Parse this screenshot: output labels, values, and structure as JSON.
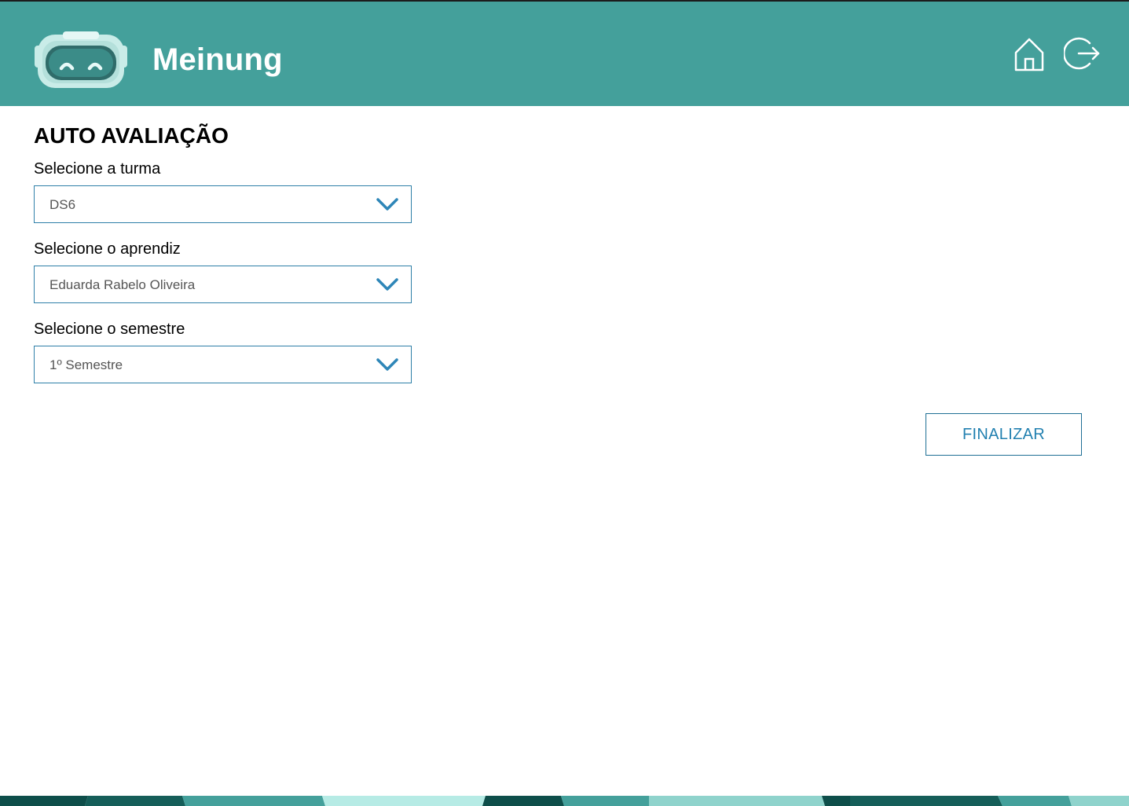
{
  "header": {
    "app_title": "Meinung",
    "colors": {
      "background": "#44a09b",
      "text": "#ffffff"
    },
    "icons": [
      "robot-logo",
      "home-icon",
      "logout-icon"
    ]
  },
  "main": {
    "page_title": "AUTO AVALIAÇÃO",
    "fields": [
      {
        "label": "Selecione a turma",
        "value": "DS6"
      },
      {
        "label": "Selecione o aprendiz",
        "value": "Eduarda Rabelo Oliveira"
      },
      {
        "label": "Selecione o semestre",
        "value": "1º Semestre"
      }
    ],
    "finalize_label": "FINALIZAR"
  },
  "colors": {
    "accent": "#2e7fa8",
    "footer": [
      "#0e4e4a",
      "#155e59",
      "#44a09b",
      "#b6ebe5",
      "#0e4e4a",
      "#44a09b",
      "#8fd3cc",
      "#0e4e4a",
      "#155e59",
      "#8fd3cc"
    ]
  }
}
